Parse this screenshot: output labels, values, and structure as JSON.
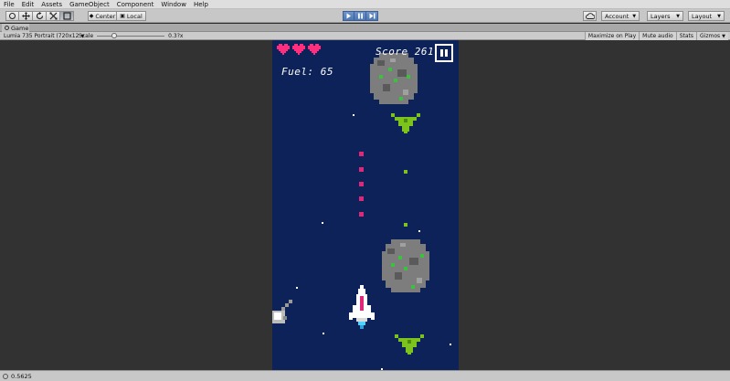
{
  "menu": [
    "File",
    "Edit",
    "Assets",
    "GameObject",
    "Component",
    "Window",
    "Help"
  ],
  "toolbar": {
    "pivot_label": "Center",
    "space_label": "Local",
    "account_label": "Account",
    "layers_label": "Layers",
    "layout_label": "Layout"
  },
  "tab": {
    "label": "Game"
  },
  "gamebar": {
    "resolution": "Lumia 735 Portrait (720x12",
    "scale_label": "Scale",
    "scale_value": "0.3?x",
    "maximize_label": "Maximize on Play",
    "mute_label": "Mute audio",
    "stats_label": "Stats",
    "gizmos_label": "Gizmos"
  },
  "hud": {
    "score": "Score 261",
    "fuel": "Fuel: 65",
    "lives": 3
  },
  "status": {
    "message": "0.5625"
  },
  "colors": {
    "space": "#0c2258",
    "heart": "#ff2e7e",
    "enemy": "#7cc41d",
    "bullet": "#e0277a",
    "editor_bg": "#323232"
  }
}
